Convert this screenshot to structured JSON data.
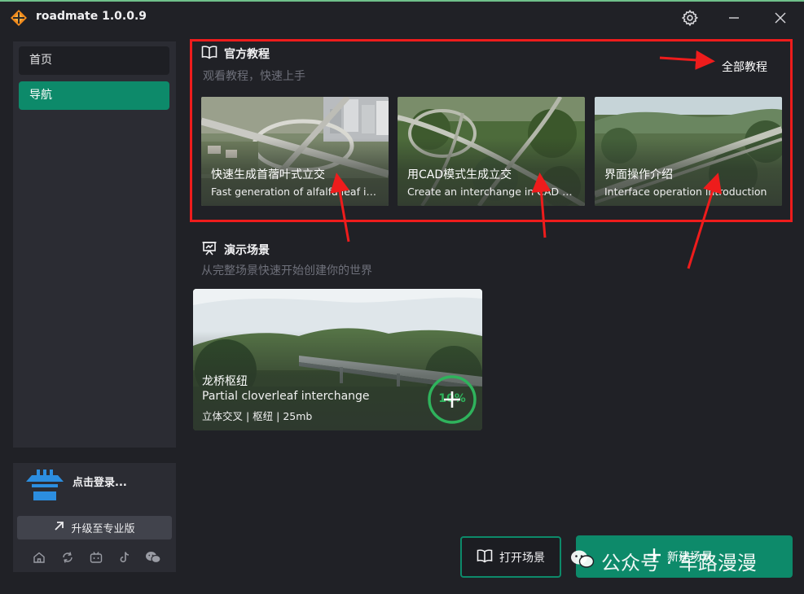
{
  "window": {
    "title": "roadmate 1.0.0.9"
  },
  "sidebar": {
    "items": [
      {
        "label": "首页"
      },
      {
        "label": "导航"
      }
    ],
    "login_label": "点击登录...",
    "upgrade_label": "升级至专业版",
    "social_icons": [
      "home-icon",
      "refresh-icon",
      "bilibili-icon",
      "tiktok-icon",
      "wechat-icon"
    ]
  },
  "tutorials": {
    "title": "官方教程",
    "subtitle": "观看教程，快速上手",
    "all_label": "全部教程",
    "cards": [
      {
        "title_cn": "快速生成首蓿叶式立交",
        "title_en": "Fast generation of alfalfa leaf interchange"
      },
      {
        "title_cn": "用CAD模式生成立交",
        "title_en": "Create an interchange in CAD mode"
      },
      {
        "title_cn": "界面操作介绍",
        "title_en": "Interface operation introduction"
      }
    ]
  },
  "scenes": {
    "title": "演示场景",
    "subtitle": "从完整场景快速开始创建你的世界",
    "cards": [
      {
        "title_cn": "龙桥枢纽",
        "title_en": "Partial cloverleaf interchange",
        "meta": "立体交叉 | 枢纽 | 25mb",
        "progress_label": "10%",
        "progress": 0.1
      }
    ]
  },
  "actions": {
    "open_label": "打开场景",
    "new_label": "新建场景"
  },
  "watermark": {
    "text": "公众号 · 车路漫漫"
  },
  "colors": {
    "accent": "#0d8a6a",
    "background": "#202126",
    "panel": "#2b2c33",
    "annotation_red": "#ee1c1c",
    "progress_green": "#2fb35c"
  }
}
